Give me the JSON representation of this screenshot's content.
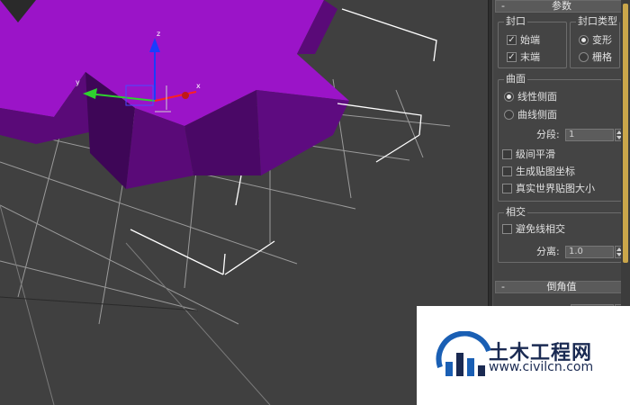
{
  "viewport": {
    "axis_labels": {
      "x": "x",
      "y": "y",
      "z": "z"
    },
    "colors": {
      "mesh_top": "#9b14c8",
      "mesh_side": "#5a0a78",
      "grid": "#9a9a9a",
      "background": "#404040"
    }
  },
  "parameters": {
    "title": "参数",
    "cap": {
      "label": "封口",
      "start": {
        "label": "始端",
        "checked": true
      },
      "end": {
        "label": "末端",
        "checked": true
      }
    },
    "cap_type": {
      "label": "封口类型",
      "morph": {
        "label": "变形",
        "selected": true
      },
      "grid": {
        "label": "栅格",
        "selected": false
      }
    },
    "surface": {
      "label": "曲面",
      "linear_sides": {
        "label": "线性侧面",
        "selected": true
      },
      "curved_sides": {
        "label": "曲线侧面",
        "selected": false
      },
      "segments_label": "分段:",
      "segments_value": "1",
      "smooth_across_levels": {
        "label": "级间平滑",
        "checked": false
      },
      "generate_map_coords": {
        "label": "生成贴图坐标",
        "checked": false
      },
      "real_world_map_size": {
        "label": "真实世界贴图大小",
        "checked": false
      }
    },
    "intersections": {
      "label": "相交",
      "keep_lines_from_crossing": {
        "label": "避免线相交",
        "checked": false
      },
      "separation_label": "分离:",
      "separation_value": "1.0"
    }
  },
  "bevel_values": {
    "title": "倒角值"
  },
  "watermark": {
    "brand": "土木工程网",
    "url": "www.civilcn.com"
  }
}
